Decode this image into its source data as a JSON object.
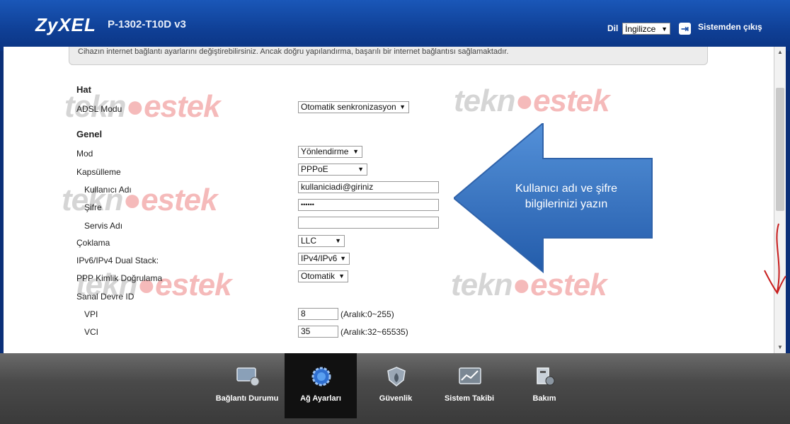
{
  "header": {
    "brand": "ZyXEL",
    "model": "P-1302-T10D v3",
    "language_label": "Dil",
    "language_value": "İngilizce",
    "logout": "Sistemden çıkış"
  },
  "notice": "Cihazın internet bağlantı ayarlarını değiştirebilirsiniz. Ancak doğru yapılandırma, başarılı bir internet bağlantısı sağlamaktadır.",
  "form": {
    "hat_section": "Hat",
    "adsl_label": "ADSL Modu",
    "adsl_value": "Otomatik senkronizasyon",
    "genel_section": "Genel",
    "mod_label": "Mod",
    "mod_value": "Yönlendirme",
    "kaps_label": "Kapsülleme",
    "kaps_value": "PPPoE",
    "user_label": "Kullanıcı Adı",
    "user_value": "kullaniciadi@giriniz",
    "pass_label": "Şifre",
    "pass_value": "••••••",
    "servis_label": "Servis Adı",
    "servis_value": "",
    "cokl_label": "Çoklama",
    "cokl_value": "LLC",
    "dual_label": "IPv6/IPv4 Dual Stack:",
    "dual_value": "IPv4/IPv6",
    "ppp_label": "PPP Kimlik Doğrulama",
    "ppp_value": "Otomatik",
    "sanal_label": "Sanal Devre ID",
    "vpi_label": "VPI",
    "vpi_value": "8",
    "vpi_hint": "(Aralık:0~255)",
    "vci_label": "VCI",
    "vci_value": "35",
    "vci_hint": "(Aralık:32~65535)"
  },
  "watermark": {
    "left": "tekn",
    "right": "estek"
  },
  "callout": "Kullanıcı adı ve şifre bilgilerinizi yazın",
  "taskbar": {
    "tabs": [
      "Bağlantı Durumu",
      "Ağ Ayarları",
      "Güvenlik",
      "Sistem Takibi",
      "Bakım"
    ],
    "active": "Ağ Ayarları"
  }
}
